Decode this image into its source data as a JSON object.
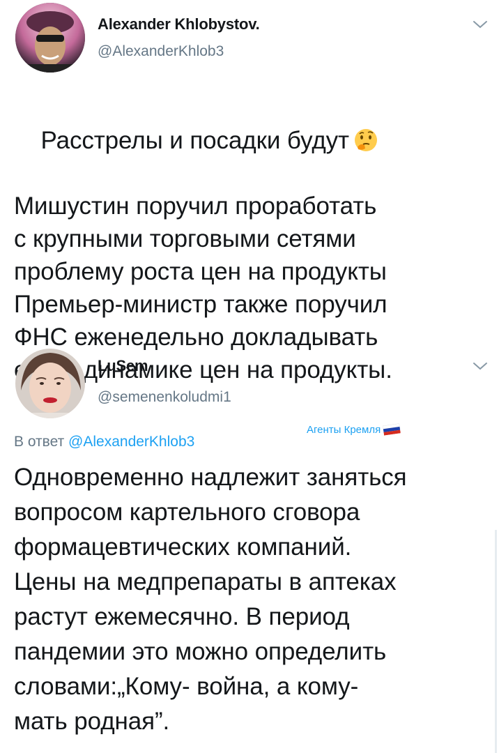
{
  "tweets": [
    {
      "author_name": "Alexander Khlobystov.",
      "author_handle": "@AlexanderKhlob3",
      "text": "Расстрелы и посадки будут\nМишустин поручил проработать\nс крупными торговыми сетями\nпроблему роста цен на продукты\nПремьер-министр также поручил\nФНС еженедельно докладывать\nему о динамике цен на продукты.",
      "emoji": "thinking-face-emoji"
    },
    {
      "author_name": "LuSem",
      "author_handle": "@semenenkoludmi1",
      "reply_prefix": "В ответ ",
      "reply_mention": "@AlexanderKhlob3",
      "group_label": "Агенты Кремля",
      "group_flag": "russian-flag-emoji",
      "text": "Одновременно надлежит заняться\nвопросом картельного сговора\nформацевтических компаний.\nЦены на медпрепараты в аптеках\nрастут ежемесячно. В период\nпандемии это можно определить\nсловами:„Кому- война, а кому-\nмать родная”."
    }
  ],
  "colors": {
    "text": "#14171a",
    "secondary": "#657786",
    "link": "#1da1f2"
  }
}
